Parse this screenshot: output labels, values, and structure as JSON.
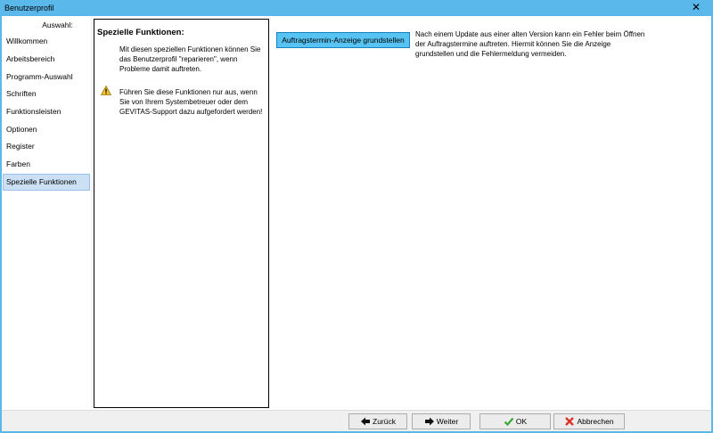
{
  "window": {
    "title": "Benutzerprofil",
    "close_label": "✕"
  },
  "sidebar": {
    "header": "Auswahl:",
    "items": [
      {
        "label": "Willkommen"
      },
      {
        "label": "Arbeitsbereich"
      },
      {
        "label": "Programm-Auswahl"
      },
      {
        "label": "Schriften"
      },
      {
        "label": "Funktionsleisten"
      },
      {
        "label": "Optionen"
      },
      {
        "label": "Register"
      },
      {
        "label": "Farben"
      },
      {
        "label": "Spezielle Funktionen",
        "selected": true
      }
    ]
  },
  "info": {
    "title": "Spezielle Funktionen:",
    "text": "Mit diesen speziellen Funktionen können Sie das Benutzerprofil \"reparieren\", wenn Probleme damit auftreten.",
    "warning": "Führen Sie diese Funktionen nur aus, wenn Sie von Ihrem Systembetreuer oder dem GEVITAS-Support dazu aufgefordert werden!",
    "warning_icon": "warning-icon"
  },
  "actions": [
    {
      "button": "Auftragstermin-Anzeige grundstellen",
      "description": "Nach einem Update aus einer alten Version kann ein Fehler beim Öffnen der Auftragstermine auftreten. Hiermit können Sie die Anzeige grundstellen und die Fehlermeldung vermeiden."
    }
  ],
  "footer": {
    "back_label": "Zurück",
    "next_label": "Weiter",
    "ok_label": "OK",
    "cancel_label": "Abbrechen"
  },
  "colors": {
    "titlebar": "#5bb8ea",
    "selected_item": "#cce0f5",
    "action_button": "#56c3f2",
    "ok_check": "#3aa832",
    "cancel_x": "#d9342b"
  }
}
